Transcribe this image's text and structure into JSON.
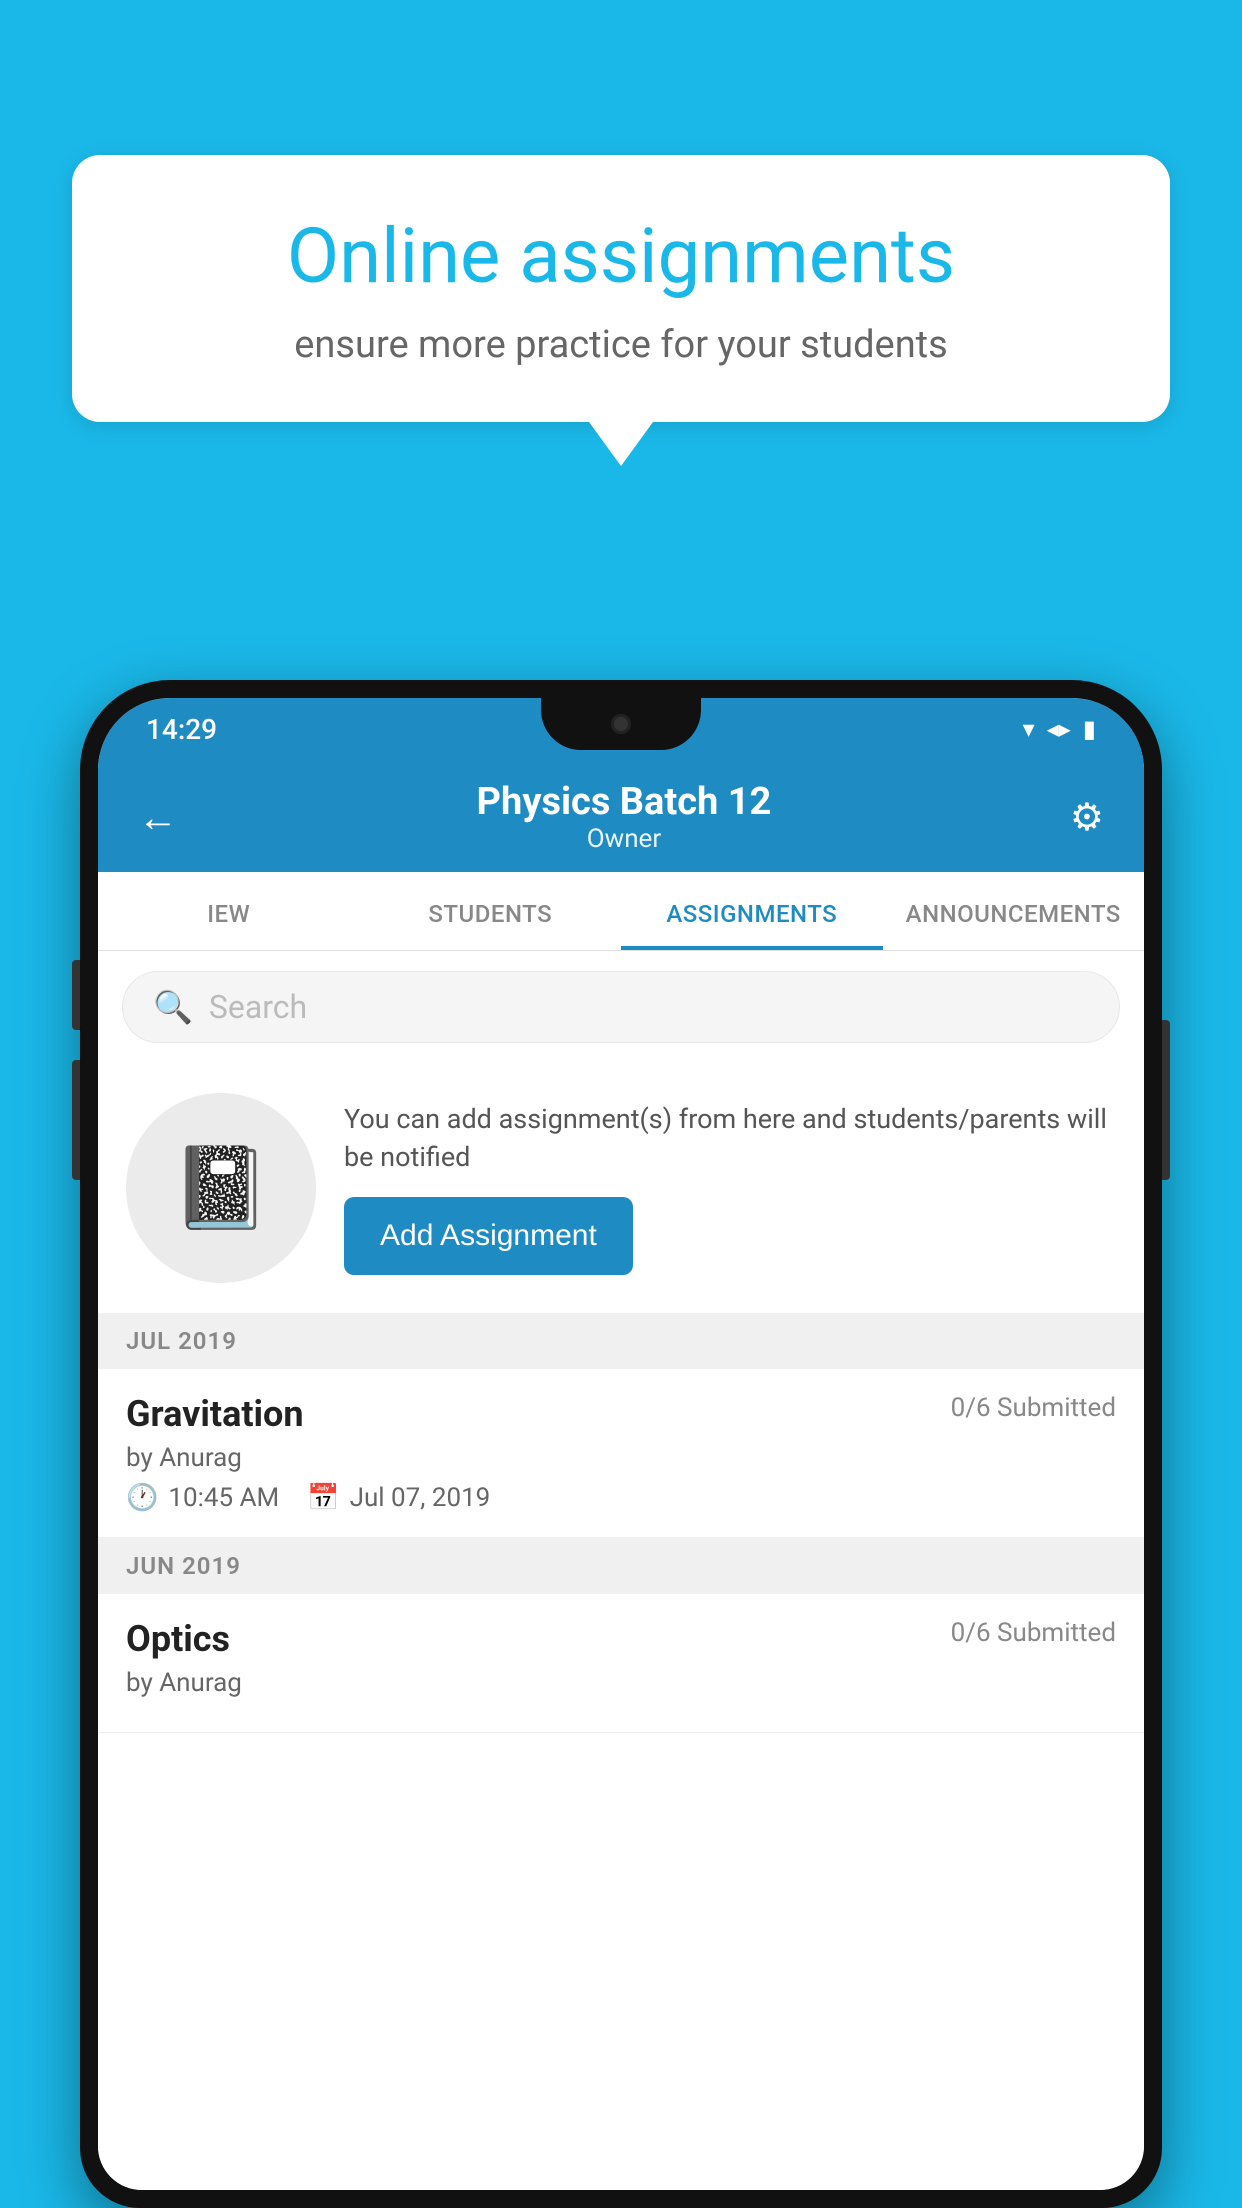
{
  "background_color": "#1ab8e8",
  "speech_bubble": {
    "title": "Online assignments",
    "subtitle": "ensure more practice for your students"
  },
  "phone": {
    "status_bar": {
      "time": "14:29",
      "icons": [
        "wifi",
        "signal",
        "battery"
      ]
    },
    "header": {
      "title": "Physics Batch 12",
      "subtitle": "Owner",
      "back_label": "←",
      "settings_label": "⚙"
    },
    "tabs": [
      {
        "label": "IEW",
        "active": false
      },
      {
        "label": "STUDENTS",
        "active": false
      },
      {
        "label": "ASSIGNMENTS",
        "active": true
      },
      {
        "label": "ANNOUNCEMENTS",
        "active": false
      }
    ],
    "search": {
      "placeholder": "Search"
    },
    "promo": {
      "description": "You can add assignment(s) from here and students/parents will be notified",
      "button_label": "Add Assignment"
    },
    "assignments": [
      {
        "month": "JUL 2019",
        "items": [
          {
            "name": "Gravitation",
            "submitted": "0/6 Submitted",
            "by": "by Anurag",
            "time": "10:45 AM",
            "date": "Jul 07, 2019"
          }
        ]
      },
      {
        "month": "JUN 2019",
        "items": [
          {
            "name": "Optics",
            "submitted": "0/6 Submitted",
            "by": "by Anurag",
            "time": "",
            "date": ""
          }
        ]
      }
    ]
  }
}
